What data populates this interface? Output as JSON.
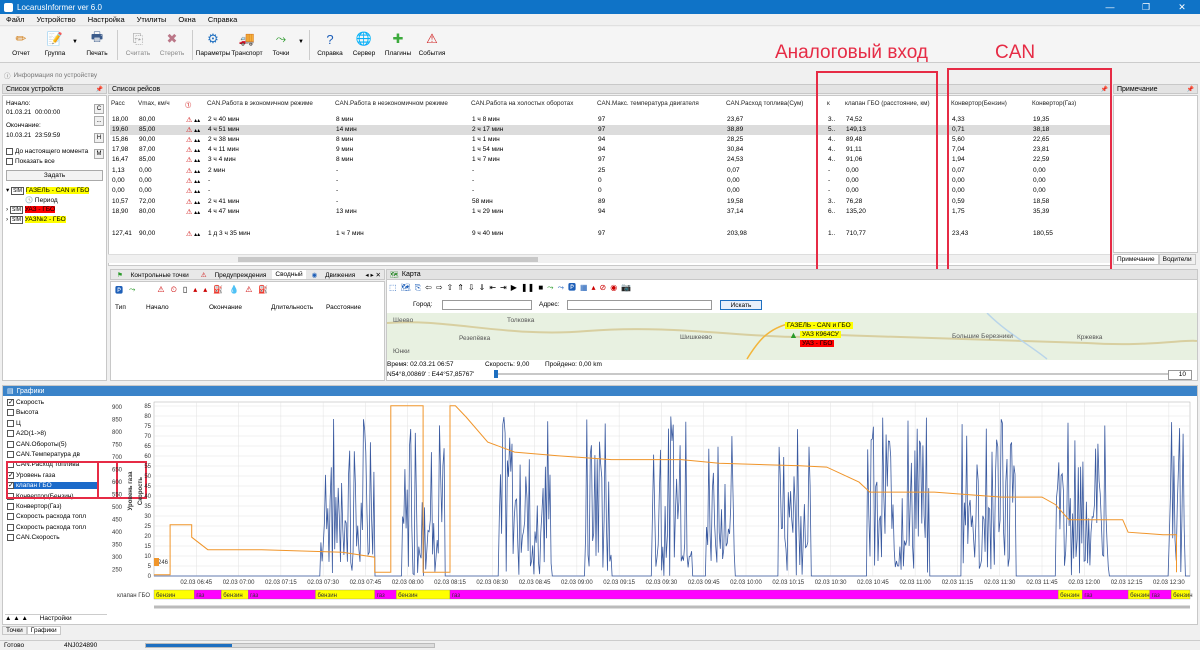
{
  "window": {
    "title": "LocarusInformer ver 6.0",
    "controls": [
      "—",
      "❐",
      "✕"
    ]
  },
  "menu": [
    "Файл",
    "Устройство",
    "Настройка",
    "Утилиты",
    "Окна",
    "Справка"
  ],
  "toolbar": [
    {
      "label": "Отчет",
      "icon": "report-icon",
      "glyph": "✏",
      "color": "#d07a10",
      "enabled": true
    },
    {
      "label": "Группа",
      "icon": "group-icon",
      "glyph": "📝",
      "color": "#8a4fb0",
      "enabled": true
    },
    {
      "label": "Печать",
      "icon": "print-icon",
      "glyph": "🖶",
      "color": "#3a5a8a",
      "enabled": true
    },
    {
      "label": "Считать",
      "icon": "read-icon",
      "glyph": "⎘",
      "color": "#999",
      "enabled": false
    },
    {
      "label": "Стереть",
      "icon": "erase-icon",
      "glyph": "✖",
      "color": "#b78",
      "enabled": false
    },
    {
      "label": "Параметры",
      "icon": "settings-icon",
      "glyph": "⚙",
      "color": "#1e6fc0",
      "enabled": true
    },
    {
      "label": "Транспорт",
      "icon": "transport-icon",
      "glyph": "🚚",
      "color": "#2d6bb8",
      "enabled": true
    },
    {
      "label": "Точки",
      "icon": "points-icon",
      "glyph": "⤳",
      "color": "#2a9a2a",
      "enabled": true
    },
    {
      "label": "Справка",
      "icon": "help-icon",
      "glyph": "?",
      "color": "#1e5fb8",
      "enabled": true
    },
    {
      "label": "Сервер",
      "icon": "server-icon",
      "glyph": "🌐",
      "color": "#1e5fb8",
      "enabled": true
    },
    {
      "label": "Плагины",
      "icon": "plugins-icon",
      "glyph": "✚",
      "color": "#3caa3c",
      "enabled": true
    },
    {
      "label": "События",
      "icon": "events-icon",
      "glyph": "⚠",
      "color": "#d01e1e",
      "enabled": true
    }
  ],
  "annotations": {
    "analog": "Аналоговый вход",
    "can": "CAN"
  },
  "device_info_label": "Информация по устройству",
  "devices_panel": {
    "title": "Список устройств",
    "start_label": "Начало:",
    "start_value": "01.03.21",
    "start_time": "00:00:00",
    "end_label": "Окончание:",
    "end_value": "10.03.21",
    "end_time": "23:59:59",
    "side_buttons": [
      "С",
      "...",
      "Н",
      "М"
    ],
    "until_now": "До настоящего момента",
    "show_all": "Показать все",
    "apply_button": "Задать",
    "tree": [
      {
        "label": "ГАЗЕЛЬ - CAN и ГБО",
        "bg": "#ffff00"
      },
      {
        "label": "Период",
        "bg": "#ffffff"
      },
      {
        "label": "УАЗ - ГБО",
        "bg": "#ff0000"
      },
      {
        "label": "УАЗ№2 - ГБО",
        "bg": "#ffff00"
      }
    ]
  },
  "trips_panel": {
    "title": "Список рейсов",
    "columns": [
      "Расс",
      "Vmax, км/ч",
      "",
      "CAN.Работа в экономичном режиме",
      "CAN.Работа в неэкономичном режиме",
      "CAN.Работа на холостых оборотах",
      "CAN.Макс. температура двигателя",
      "CAN.Расход топлива(Сум)",
      "к",
      "клапан ГБО (расстояние, км)",
      "Конвертор(Бензин)",
      "Конвертор(Газ)"
    ],
    "rows": [
      {
        "c": [
          "18,00",
          "80,00",
          "",
          "2 ч 40 мин",
          "8 мин",
          "1 ч 8 мин",
          "97",
          "23,67",
          "3..",
          "74,52",
          "4,33",
          "19,35"
        ],
        "sel": false
      },
      {
        "c": [
          "19,60",
          "85,00",
          "",
          "4 ч 51 мин",
          "14 мин",
          "2 ч 17 мин",
          "97",
          "38,89",
          "5..",
          "149,13",
          "0,71",
          "38,18"
        ],
        "sel": true
      },
      {
        "c": [
          "15,86",
          "90,00",
          "",
          "2 ч 38 мин",
          "8 мин",
          "1 ч 1 мин",
          "94",
          "28,25",
          "4..",
          "89,48",
          "5,60",
          "22,65"
        ],
        "sel": false
      },
      {
        "c": [
          "17,98",
          "87,00",
          "",
          "4 ч 11 мин",
          "9 мин",
          "1 ч 54 мин",
          "94",
          "30,84",
          "4..",
          "91,11",
          "7,04",
          "23,81"
        ],
        "sel": false
      },
      {
        "c": [
          "16,47",
          "85,00",
          "",
          "3 ч 4 мин",
          "8 мин",
          "1 ч 7 мин",
          "97",
          "24,53",
          "4..",
          "91,06",
          "1,94",
          "22,59"
        ],
        "sel": false
      },
      {
        "c": [
          "1,13",
          "0,00",
          "",
          "2 мин",
          "-",
          "-",
          "25",
          "0,07",
          "-",
          "0,00",
          "0,07",
          "0,00"
        ],
        "sel": false
      },
      {
        "c": [
          "0,00",
          "0,00",
          "",
          "-",
          "-",
          "-",
          "0",
          "0,00",
          "-",
          "0,00",
          "0,00",
          "0,00"
        ],
        "sel": false
      },
      {
        "c": [
          "0,00",
          "0,00",
          "",
          "-",
          "-",
          "-",
          "0",
          "0,00",
          "-",
          "0,00",
          "0,00",
          "0,00"
        ],
        "sel": false
      },
      {
        "c": [
          "10,57",
          "72,00",
          "",
          "2 ч 41 мин",
          "-",
          "58 мин",
          "89",
          "19,58",
          "3..",
          "76,28",
          "0,59",
          "18,58"
        ],
        "sel": false
      },
      {
        "c": [
          "18,90",
          "80,00",
          "",
          "4 ч 47 мин",
          "13 мин",
          "1 ч 29 мин",
          "94",
          "37,14",
          "6..",
          "135,20",
          "1,75",
          "35,39"
        ],
        "sel": false
      },
      {
        "c": [
          "127,41",
          "90,00",
          "",
          "1 д 3 ч 35 мин",
          "1 ч 7 мин",
          "9 ч 40 мин",
          "97",
          "203,98",
          "1..",
          "710,77",
          "23,43",
          "180,55"
        ],
        "sel": false
      }
    ]
  },
  "notes_panel": {
    "title": "Примечание",
    "tabs": [
      "Примечание",
      "Водители"
    ]
  },
  "control_panel": {
    "tabs": [
      "Контрольные точки",
      "Предупреждения",
      "Сводный",
      "Движения"
    ],
    "columns": [
      "Тип",
      "Начало",
      "Окончание",
      "Длительность",
      "Расстояние"
    ]
  },
  "map_panel": {
    "title": "Карта",
    "city_label": "Город:",
    "address_label": "Адрес:",
    "search_button": "Искать",
    "places": [
      "Толковка",
      "Резепёвка",
      "Шишкеево",
      "Большие Березники",
      "Кржевка",
      "Юнки",
      "Шеево"
    ],
    "vehicles": [
      {
        "label": "ГАЗЕЛЬ - CAN и ГБО",
        "bg": "#ffff00"
      },
      {
        "label": "УАЗ К964СУ",
        "bg": "#ffff00"
      },
      {
        "label": "УАЗ - ГБО",
        "bg": "#ff0000"
      }
    ],
    "status": {
      "time": "Время: 02.03.21 06:57",
      "speed": "Скорость: 9,00",
      "distance": "Пройдено: 0,00 km"
    },
    "coords": "N54°8,00869' : E44°57,85767'",
    "zoom": "10"
  },
  "charts_panel": {
    "title": "Графики",
    "series_list": [
      {
        "label": "Скорость",
        "checked": true,
        "hl": false
      },
      {
        "label": "Высота",
        "checked": false,
        "hl": false
      },
      {
        "label": "Ц",
        "checked": false,
        "hl": false
      },
      {
        "label": "A2D(1->8)",
        "checked": false,
        "hl": false
      },
      {
        "label": "CAN.Обороты(5)",
        "checked": false,
        "hl": false
      },
      {
        "label": "CAN.Температура дв",
        "checked": false,
        "hl": false
      },
      {
        "label": "CAN.Расход топлива",
        "checked": false,
        "hl": false
      },
      {
        "label": "Уровень газа",
        "checked": true,
        "hl": false
      },
      {
        "label": "клапан ГБО",
        "checked": true,
        "hl": true
      },
      {
        "label": "Конвертор(Бензин)",
        "checked": false,
        "hl": false
      },
      {
        "label": "Конвертор(Газ)",
        "checked": false,
        "hl": false
      },
      {
        "label": "Скорость расхода топл",
        "checked": false,
        "hl": false
      },
      {
        "label": "Скорость расхода топл",
        "checked": false,
        "hl": false
      },
      {
        "label": "CAN.Скорость",
        "checked": false,
        "hl": false
      }
    ],
    "settings_label": "Настройки",
    "bottom_tabs": [
      "Точки",
      "Графики"
    ],
    "valve_label": "клапан ГБО"
  },
  "chart_data": {
    "type": "line",
    "x_labels": [
      "02.03 06:45",
      "02.03 07:00",
      "02.03 07:15",
      "02.03 07:30",
      "02.03 07:45",
      "02.03 08:00",
      "02.03 08:15",
      "02.03 08:30",
      "02.03 08:45",
      "02.03 09:00",
      "02.03 09:15",
      "02.03 09:30",
      "02.03 09:45",
      "02.03 10:00",
      "02.03 10:15",
      "02.03 10:30",
      "02.03 10:45",
      "02.03 11:00",
      "02.03 11:15",
      "02.03 11:30",
      "02.03 11:45",
      "02.03 12:00",
      "02.03 12:15",
      "02.03 12:30"
    ],
    "gas_axis": {
      "label": "Уровень газа",
      "ticks": [
        250,
        300,
        350,
        400,
        450,
        500,
        550,
        600,
        650,
        700,
        750,
        800,
        850,
        900
      ],
      "range": [
        225,
        920
      ]
    },
    "speed_axis": {
      "label": "Скорость",
      "ticks": [
        0,
        5,
        10,
        15,
        20,
        25,
        30,
        35,
        40,
        45,
        50,
        55,
        60,
        65,
        70,
        75,
        80,
        85
      ],
      "range": [
        0,
        87
      ]
    },
    "cursor_value": "246",
    "series": [
      {
        "name": "Скорость",
        "color": "#3a5aa0"
      },
      {
        "name": "Уровень газа",
        "color": "#f0952a",
        "points": [
          [
            0,
            230
          ],
          [
            6,
            230
          ],
          [
            6,
            430
          ],
          [
            14,
            430
          ],
          [
            14,
            380
          ],
          [
            20,
            330
          ],
          [
            40,
            330
          ],
          [
            70,
            320
          ],
          [
            82,
            300
          ],
          [
            82,
            240
          ],
          [
            88,
            240
          ],
          [
            88,
            905
          ],
          [
            100,
            905
          ],
          [
            100,
            240
          ],
          [
            110,
            240
          ],
          [
            110,
            905
          ],
          [
            112,
            905
          ],
          [
            116,
            860
          ],
          [
            124,
            760
          ],
          [
            134,
            720
          ],
          [
            150,
            705
          ],
          [
            170,
            690
          ],
          [
            196,
            690
          ],
          [
            210,
            675
          ],
          [
            240,
            665
          ],
          [
            250,
            660
          ],
          [
            262,
            600
          ],
          [
            266,
            560
          ],
          [
            290,
            560
          ],
          [
            315,
            540
          ],
          [
            330,
            540
          ],
          [
            335,
            510
          ],
          [
            340,
            450
          ],
          [
            360,
            450
          ],
          [
            362,
            400
          ],
          [
            375,
            390
          ],
          [
            380,
            390
          ],
          [
            380,
            240
          ]
        ]
      },
      {
        "name": "клапан ГБО",
        "segments": [
          {
            "start": 0,
            "end": 15,
            "value": "бензин"
          },
          {
            "start": 15,
            "end": 25,
            "value": "газ"
          },
          {
            "start": 25,
            "end": 35,
            "value": "бензин"
          },
          {
            "start": 35,
            "end": 60,
            "value": "газ"
          },
          {
            "start": 60,
            "end": 82,
            "value": "бензин"
          },
          {
            "start": 82,
            "end": 90,
            "value": "газ"
          },
          {
            "start": 90,
            "end": 110,
            "value": "бензин"
          },
          {
            "start": 110,
            "end": 336,
            "value": "газ"
          },
          {
            "start": 336,
            "end": 345,
            "value": "бензин"
          },
          {
            "start": 345,
            "end": 362,
            "value": "газ"
          },
          {
            "start": 362,
            "end": 370,
            "value": "бензин"
          },
          {
            "start": 370,
            "end": 378,
            "value": "газ"
          },
          {
            "start": 378,
            "end": 385,
            "value": "бензин"
          }
        ],
        "colors": {
          "бензин": "#ffff00",
          "газ": "#ff00ff"
        }
      }
    ]
  },
  "statusbar": {
    "left": "Готово",
    "serial": "4NJ024890"
  }
}
